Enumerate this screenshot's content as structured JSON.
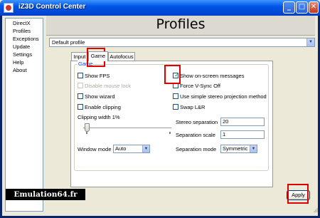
{
  "window": {
    "title": "iZ3D Control Center"
  },
  "titlebar_buttons": {
    "minimize": "_",
    "maximize": "□",
    "close": "✕"
  },
  "sidebar": {
    "items": [
      {
        "label": "DirectX"
      },
      {
        "label": "Profiles"
      },
      {
        "label": "Exceptions"
      },
      {
        "label": "Update"
      },
      {
        "label": "Settings"
      },
      {
        "label": "Help"
      },
      {
        "label": "About"
      }
    ]
  },
  "header": {
    "title": "Profiles"
  },
  "profile_selector": {
    "value": "Default profile"
  },
  "tabs": [
    {
      "label": "Input",
      "active": false
    },
    {
      "label": "Game",
      "active": true
    },
    {
      "label": "Autofocus",
      "active": false
    }
  ],
  "game_group": {
    "title": "Game",
    "left_options": [
      {
        "label": "Show FPS",
        "checked": false,
        "enabled": true
      },
      {
        "label": "Disable mouse lock",
        "checked": false,
        "enabled": false
      },
      {
        "label": "Show wizard",
        "checked": false,
        "enabled": true
      },
      {
        "label": "Enable clipping",
        "checked": false,
        "enabled": true
      }
    ],
    "right_options": [
      {
        "label": "Show on-screen messages",
        "checked": true,
        "enabled": true
      },
      {
        "label": "Force V-Sync Off",
        "checked": false,
        "enabled": true
      },
      {
        "label": "Use simple stereo projection method",
        "checked": false,
        "enabled": true
      },
      {
        "label": "Swap L&R",
        "checked": false,
        "enabled": true
      }
    ],
    "clipping_width": {
      "label": "Clipping width 1%",
      "value_percent": 1
    },
    "stereo_separation": {
      "label": "Stereo separation",
      "value": "20"
    },
    "separation_scale": {
      "label": "Separation scale",
      "value": "1"
    },
    "window_mode": {
      "label": "Window mode",
      "value": "Auto"
    },
    "separation_mode": {
      "label": "Separation mode",
      "value": "Symmetric"
    }
  },
  "watermark": "Emulation64.fr",
  "apply_button": {
    "label": "Apply"
  },
  "colors": {
    "highlight": "#e00000",
    "titlebar": "#0055e5",
    "group_title": "#0046d5"
  }
}
